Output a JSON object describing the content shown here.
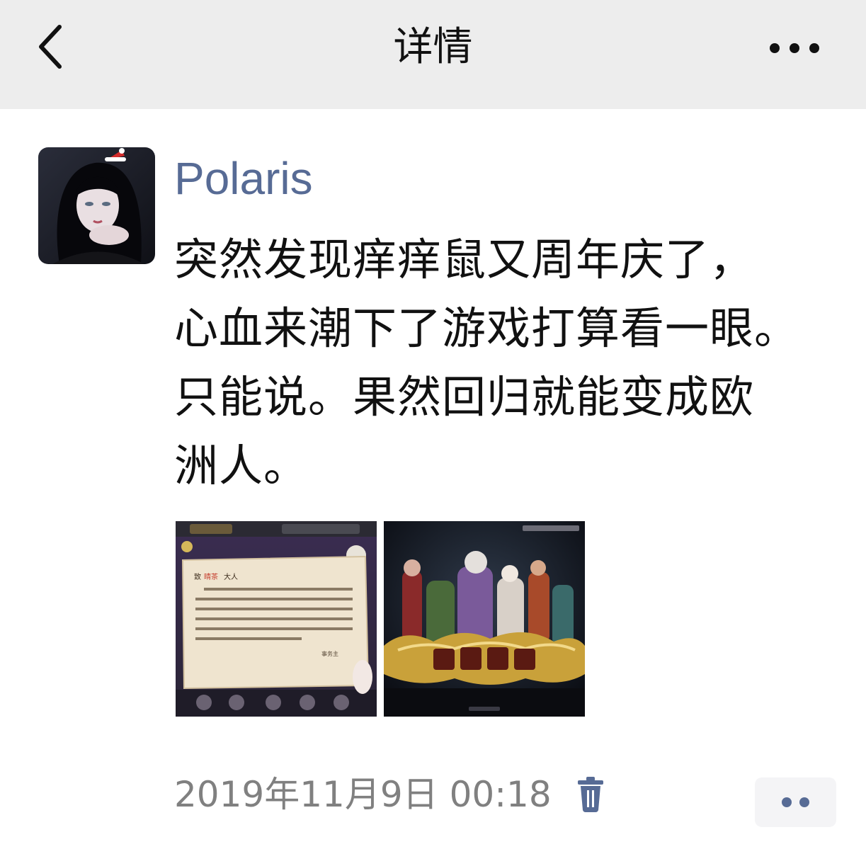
{
  "navbar": {
    "title": "详情",
    "back_icon": "chevron-left-icon",
    "more_icon": "more-dots-icon"
  },
  "post": {
    "author": "Polaris",
    "avatar": "avatar-image",
    "text_lines": [
      "突然发现痒痒鼠又周年庆了，",
      "心血来潮下了游戏打算看一眼。",
      "只能说。果然回归就能变成欧",
      "洲人。"
    ],
    "photos": [
      {
        "name": "letter-screenshot",
        "letter_salutation": "致",
        "letter_name": "晴茶",
        "letter_title": "大人",
        "letter_signature": "事务主"
      },
      {
        "name": "event-banner-screenshot"
      }
    ],
    "timestamp": "2019年11月9日 00:18",
    "delete_icon": "trash-icon",
    "action_icon": "two-dots-icon"
  },
  "colors": {
    "navbar_bg": "#ededed",
    "author_link": "#576b95",
    "text": "#111111",
    "timestamp": "#808080"
  }
}
